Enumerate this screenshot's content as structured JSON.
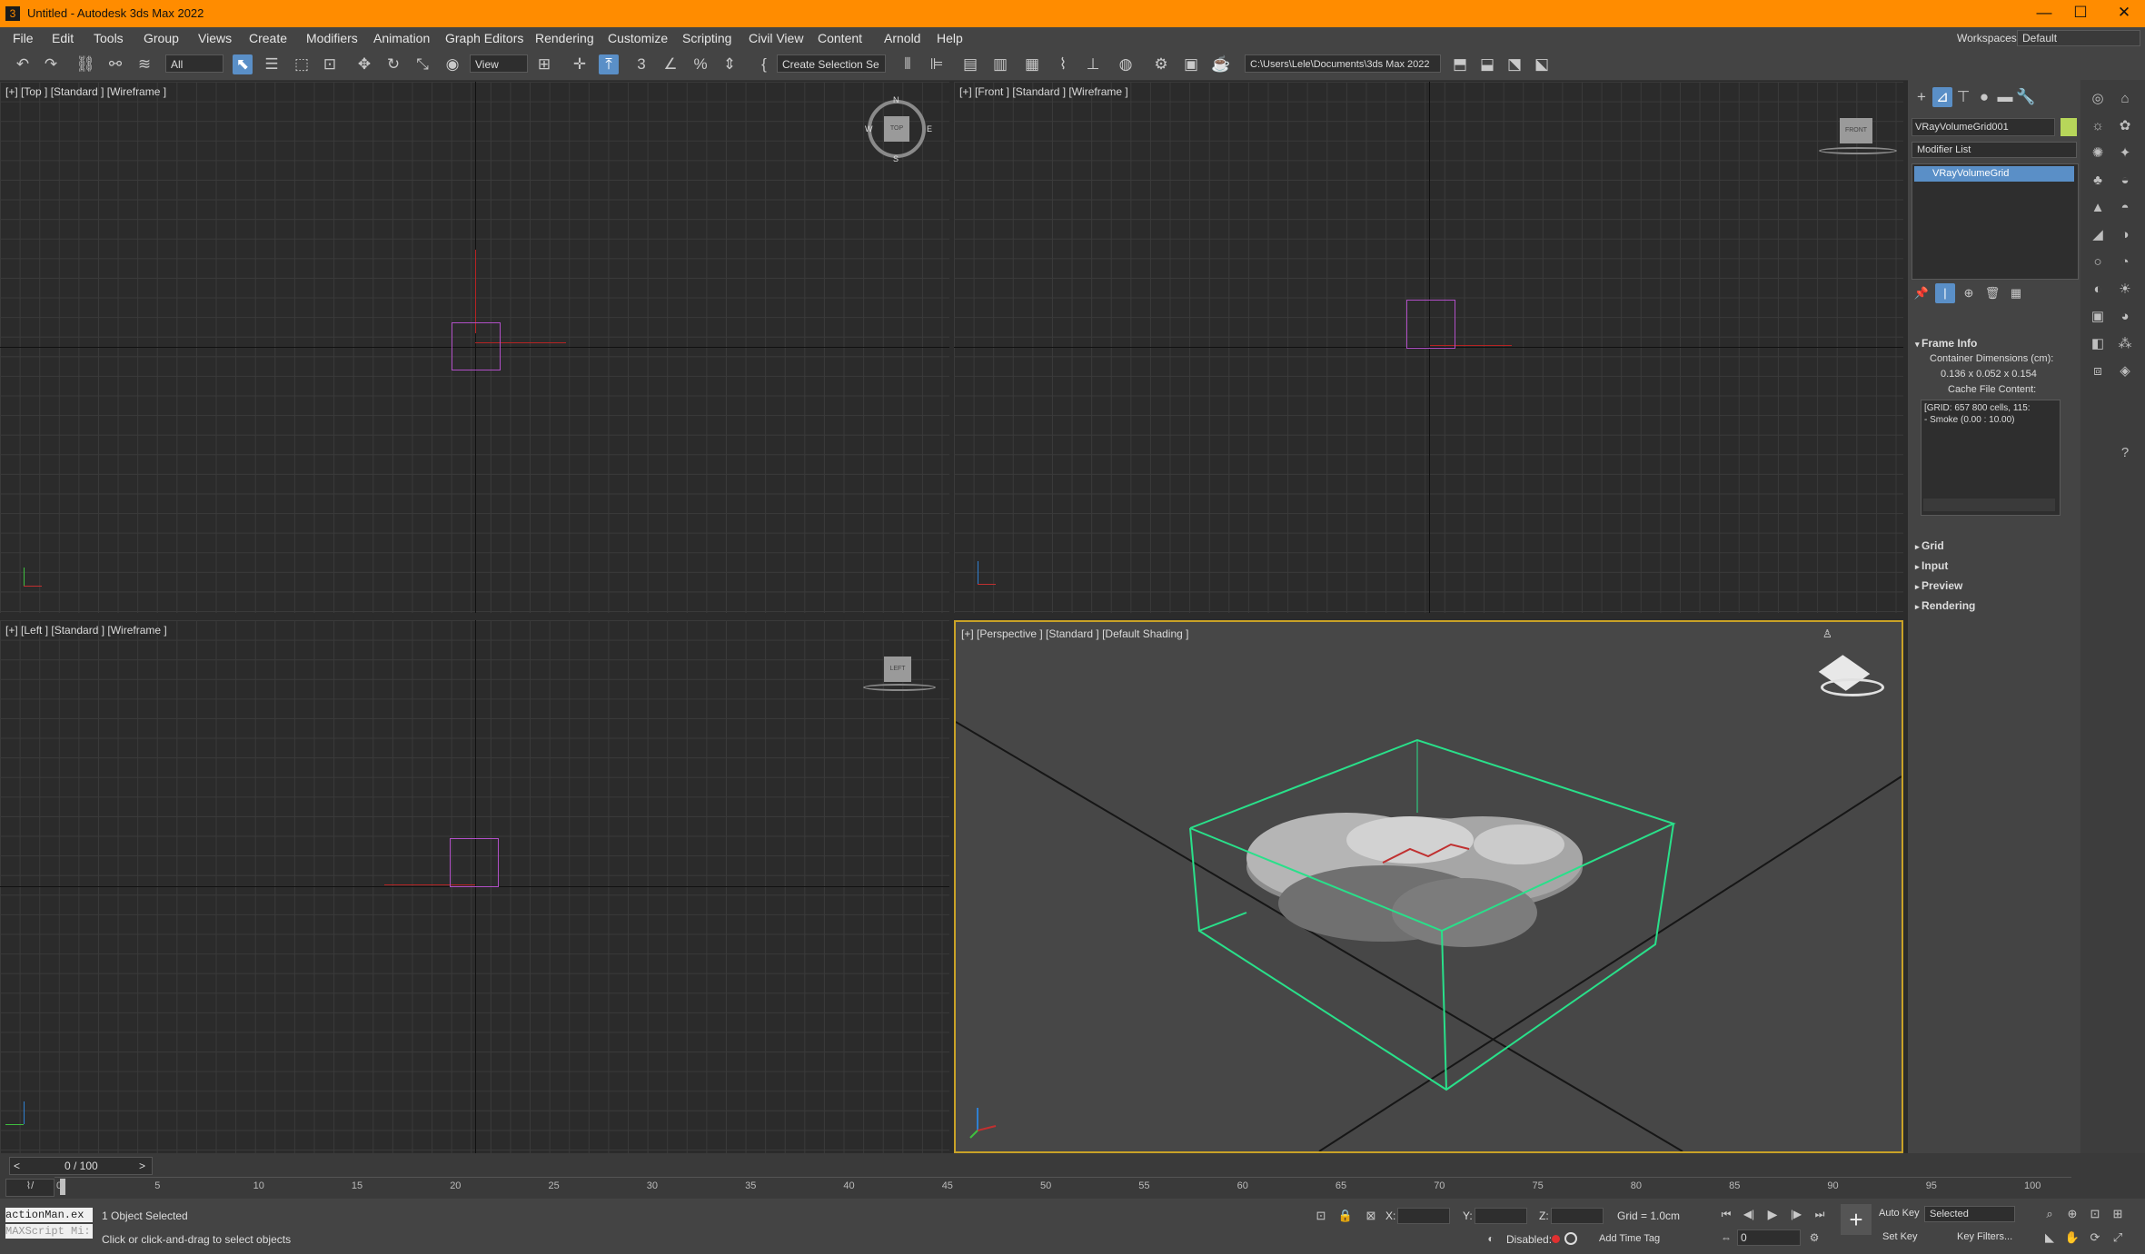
{
  "app": {
    "title": "Untitled - Autodesk 3ds Max 2022",
    "icon_glyph": "3"
  },
  "window_controls": {
    "minimize": "—",
    "maximize": "☐",
    "close": "✕"
  },
  "menu": [
    "File",
    "Edit",
    "Tools",
    "Group",
    "Views",
    "Create",
    "Modifiers",
    "Animation",
    "Graph Editors",
    "Rendering",
    "Customize",
    "Scripting",
    "Civil View",
    "Content",
    "Arnold",
    "Help"
  ],
  "workspace": {
    "label": "Workspaces:",
    "value": "Default"
  },
  "toolbar": {
    "filter_value": "All",
    "refcoord_value": "View",
    "selection_set": "Create Selection Se",
    "project_path": "C:\\Users\\Lele\\Documents\\3ds Max 2022"
  },
  "viewports": {
    "top": "[+] [Top ] [Standard ] [Wireframe ]",
    "front": "[+] [Front ] [Standard ] [Wireframe ]",
    "left": "[+] [Left ] [Standard ] [Wireframe ]",
    "perspective": "[+] [Perspective ] [Standard ] [Default Shading ]"
  },
  "viewcube": {
    "top_face": "TOP",
    "front_face": "FRONT",
    "left_face": "LEFT",
    "n": "N",
    "s": "S",
    "e": "E",
    "w": "W"
  },
  "command_panel": {
    "object_name": "VRayVolumeGrid001",
    "object_color": "#b7d65a",
    "modifier_list": "Modifier List",
    "stack_item": "VRayVolumeGrid",
    "frame_info": {
      "title": "Frame Info",
      "container_label": "Container Dimensions (cm):",
      "container_value": "0.136 x 0.052 x 0.154",
      "cache_label": "Cache File Content:",
      "cache_lines": [
        "[GRID: 657 800 cells, 115:",
        "- Smoke (0.00 : 10.00)"
      ]
    },
    "rollouts": [
      "Grid",
      "Input",
      "Preview",
      "Rendering"
    ]
  },
  "timeline": {
    "frame_counter": "0 / 100",
    "prev": "<",
    "next": ">",
    "ticks": [
      "0",
      "5",
      "10",
      "15",
      "20",
      "25",
      "30",
      "35",
      "40",
      "45",
      "50",
      "55",
      "60",
      "65",
      "70",
      "75",
      "80",
      "85",
      "90",
      "95",
      "100"
    ]
  },
  "status": {
    "script_listener": "actionMan.ex",
    "maxscript_placeholder": "MAXScript Mi:",
    "selected": "1 Object Selected",
    "prompt": "Click or click-and-drag to select objects",
    "x_label": "X:",
    "y_label": "Y:",
    "z_label": "Z:",
    "grid": "Grid = 1.0cm",
    "disabled_label": "Disabled:",
    "add_time_tag": "Add Time Tag",
    "auto_key": "Auto Key",
    "set_key": "Set Key",
    "selected_dropdown": "Selected",
    "key_filters": "Key Filters...",
    "frame_field": "0"
  },
  "colors": {
    "title_bar": "#ff8c00",
    "selection_box": "#b14fc7",
    "bounding_box": "#29e08a",
    "accent_blue": "#5a8fc7"
  }
}
